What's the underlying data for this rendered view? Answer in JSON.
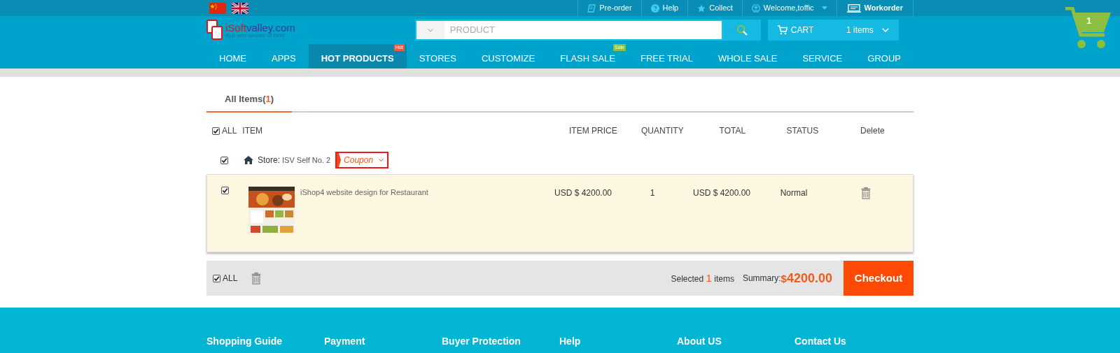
{
  "topbar": {
    "flags": [
      {
        "kind": "cn"
      },
      {
        "kind": "uk"
      }
    ],
    "links": [
      {
        "kind": "preorder",
        "label": "Pre-order"
      },
      {
        "kind": "help",
        "label": "Help"
      },
      {
        "kind": "star",
        "label": "Collect"
      },
      {
        "kind": "user",
        "label": "Welcome,toffic",
        "dropdown": true
      },
      {
        "kind": "workorder",
        "label": "Workorder"
      }
    ]
  },
  "header": {
    "logo": {
      "parts": [
        "iSoft",
        "valley.com"
      ],
      "tagline": "App and service of here"
    },
    "search": {
      "placeholder": "PRODUCT"
    },
    "cart": {
      "label": "CART",
      "count": "1 items"
    },
    "cart_badge": "1"
  },
  "nav": [
    {
      "label": "HOME",
      "selected": false
    },
    {
      "label": "APPS",
      "selected": false
    },
    {
      "label": "HOT PRODUCTS",
      "selected": true,
      "badge": "Hot",
      "color": "#f05a3c"
    },
    {
      "label": "STORES",
      "selected": false
    },
    {
      "label": "CUSTOMIZE",
      "selected": false
    },
    {
      "label": "FLASH SALE",
      "selected": false,
      "badge": "Sale",
      "color": "#8cbf3f"
    },
    {
      "label": "FREE TRIAL",
      "selected": false
    },
    {
      "label": "WHOLE SALE",
      "selected": false
    },
    {
      "label": "SERVICE",
      "selected": false
    },
    {
      "label": "GROUP",
      "selected": false
    }
  ],
  "tabs": [
    {
      "label": "All Items(",
      "count": "1",
      "close": ")",
      "selected": true
    }
  ],
  "columns": {
    "all": {
      "label": "ALL",
      "checked": true
    },
    "headers": [
      "ITEM",
      "ITEM PRICE",
      "QUANTITY",
      "TOTAL",
      "STATUS",
      "Delete"
    ]
  },
  "store": {
    "checked": true,
    "label": "Store:",
    "name": "ISV Self No. 2",
    "coupon": "Coupon"
  },
  "items": [
    {
      "checked": true,
      "kind": "picture",
      "title": "iShop4 website design for Restaurant",
      "price": "USD $ 4200.00",
      "quantity": "1",
      "total": "USD $ 4200.00",
      "status": "Normal"
    }
  ],
  "footer_bar": {
    "all": {
      "label": "ALL",
      "checked": true
    },
    "selected": [
      "Selected ",
      "1",
      " items"
    ],
    "summary_label": "Summary:",
    "currency": "$",
    "amount": "4200.00",
    "checkout": "Checkout"
  },
  "footer": [
    "Shopping Guide",
    "Payment",
    "Buyer Protection",
    "Help",
    "About US",
    "Contact Us"
  ]
}
